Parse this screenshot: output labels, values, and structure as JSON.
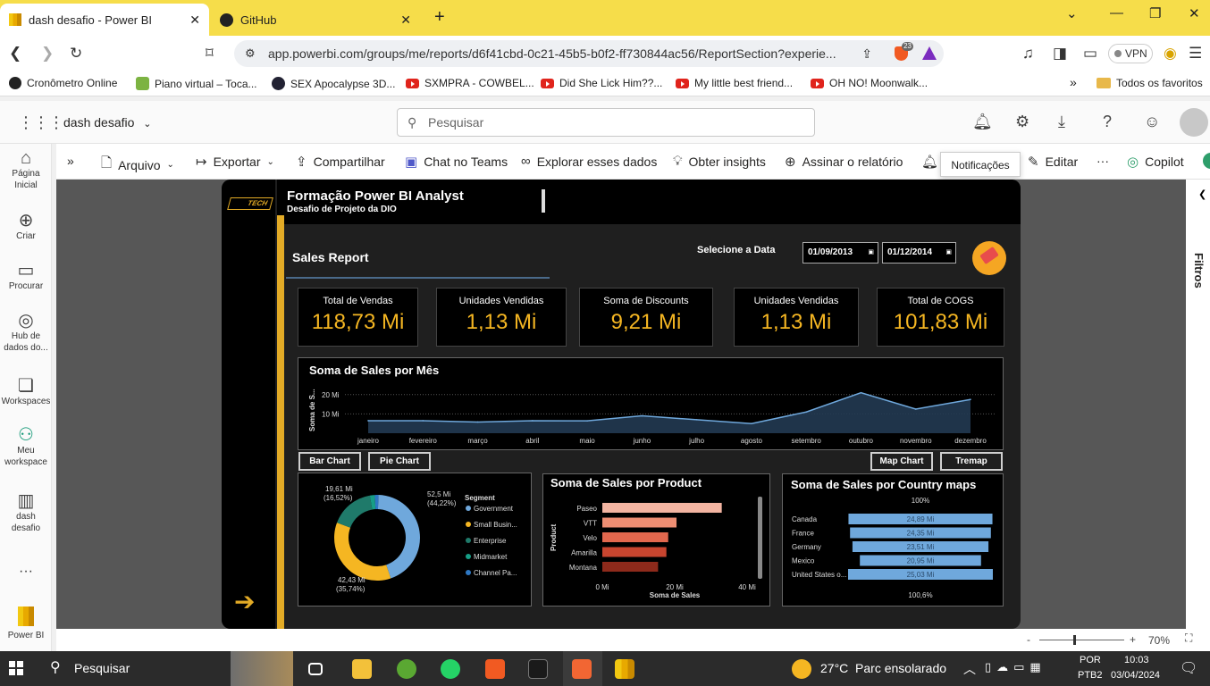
{
  "browser": {
    "tabs": [
      {
        "label": "dash desafio - Power BI",
        "active": true
      },
      {
        "label": "GitHub",
        "active": false
      }
    ],
    "url": "app.powerbi.com/groups/me/reports/d6f41cbd-0c21-45b5-b0f2-ff730844ac56/ReportSection?experie...",
    "brave_badge": "23",
    "vpn_label": "VPN",
    "bookmarks": [
      "Cronômetro Online",
      "Piano virtual – Toca...",
      "SEX Apocalypse 3D...",
      "SXMPRA - COWBEL...",
      "Did She Lick Him??...",
      "My little best friend...",
      "OH NO! Moonwalk..."
    ],
    "bookmarks_more": "»",
    "all_favorites": "Todos os favoritos"
  },
  "pbi": {
    "report_name": "dash desafio",
    "search_placeholder": "Pesquisar",
    "ribbon": [
      "Arquivo",
      "Exportar",
      "Compartilhar",
      "Chat no Teams",
      "Explorar esses dados",
      "Obter insights",
      "Assinar o relatório",
      "Editar",
      "Copilot"
    ],
    "ribbon_more": "···",
    "tooltip": "Notificações",
    "nav": [
      {
        "label": "Página Inicial",
        "icon": "home-icon"
      },
      {
        "label": "Criar",
        "icon": "plus-circle-icon"
      },
      {
        "label": "Procurar",
        "icon": "folder-icon"
      },
      {
        "label": "Hub de dados do...",
        "icon": "data-hub-icon"
      },
      {
        "label": "Workspaces",
        "icon": "workspaces-icon"
      },
      {
        "label": "Meu workspace",
        "icon": "person-icon"
      },
      {
        "label": "dash desafio",
        "icon": "report-icon"
      },
      {
        "label": "···",
        "icon": "more-icon"
      },
      {
        "label": "Power BI",
        "icon": "powerbi-logo"
      }
    ],
    "filters_label": "Filtros",
    "zoom": "70%",
    "zoom_minus": "-",
    "zoom_plus": "+"
  },
  "report": {
    "logo_text": "TECH",
    "title": "Formação Power BI Analyst",
    "subtitle": "Desafio de Projeto da DIO",
    "page_title": "Sales Report",
    "date_label": "Selecione a Data",
    "date_from": "01/09/2013",
    "date_to": "01/12/2014",
    "kpis": [
      {
        "label": "Total de Vendas",
        "value": "118,73 Mi"
      },
      {
        "label": "Unidades Vendidas",
        "value": "1,13 Mi"
      },
      {
        "label": "Soma de Discounts",
        "value": "9,21 Mi"
      },
      {
        "label": "Unidades Vendidas",
        "value": "1,13 Mi"
      },
      {
        "label": "Total de COGS",
        "value": "101,83 Mi"
      }
    ],
    "buttons": [
      "Bar Chart",
      "Pie Chart",
      "Map Chart",
      "Tremap"
    ],
    "accent": "#e3ab26",
    "kpi_color": "#f5b622"
  },
  "chart_data": [
    {
      "type": "area",
      "title": "Soma de Sales por Mês",
      "ylabel": "Soma de S...",
      "categories": [
        "janeiro",
        "fevereiro",
        "março",
        "abril",
        "maio",
        "junho",
        "julho",
        "agosto",
        "setembro",
        "outubro",
        "novembro",
        "dezembro"
      ],
      "values": [
        6.5,
        6.5,
        5.8,
        6.5,
        6.4,
        9.0,
        7.0,
        5.0,
        11.0,
        21.0,
        12.5,
        17.5
      ],
      "yticks": [
        "10 Mi",
        "20 Mi"
      ],
      "ylim": [
        0,
        25
      ]
    },
    {
      "type": "pie",
      "legend_title": "Segment",
      "labels": [
        "Government",
        "Small Busin...",
        "Enterprise",
        "Midmarket",
        "Channel Pa..."
      ],
      "values": [
        52.5,
        42.43,
        19.61,
        2.2,
        1.6
      ],
      "colors": [
        "#6fa8dc",
        "#f5b622",
        "#1f7a6a",
        "#179e86",
        "#2e78c4"
      ],
      "data_labels": [
        {
          "value": "52,5 Mi",
          "pct": "(44,22%)"
        },
        {
          "value": "42,43 Mi",
          "pct": "(35,74%)"
        },
        {
          "value": "19,61 Mi",
          "pct": "(16,52%)"
        }
      ]
    },
    {
      "type": "bar",
      "title": "Soma de Sales por Product",
      "ylabel": "Product",
      "xlabel": "Soma de Sales",
      "categories": [
        "Paseo",
        "VTT",
        "Velo",
        "Amarilla",
        "Montana"
      ],
      "values": [
        33.0,
        20.5,
        18.2,
        17.7,
        15.4
      ],
      "colors": [
        "#f2b4a1",
        "#ee8e73",
        "#e2684e",
        "#c8452f",
        "#8e2a1b"
      ],
      "xticks": [
        "0 Mi",
        "20 Mi",
        "40 Mi"
      ],
      "xlim": [
        0,
        40
      ]
    },
    {
      "type": "bar",
      "title": "Soma de Sales por Country maps",
      "categories": [
        "Canada",
        "France",
        "Germany",
        "Mexico",
        "United States o..."
      ],
      "values": [
        24.89,
        24.35,
        23.51,
        20.95,
        25.03
      ],
      "value_labels": [
        "24,89 Mi",
        "24,35 Mi",
        "23,51 Mi",
        "20,95 Mi",
        "25,03 Mi"
      ],
      "top_label": "100%",
      "bottom_label": "100,6%",
      "color": "#6fa8dc"
    }
  ],
  "taskbar": {
    "search": "Pesquisar",
    "weather": "27°C  Parc ensolarado",
    "lang1": "POR",
    "lang2": "PTB2",
    "time": "10:03",
    "date": "03/04/2024"
  }
}
